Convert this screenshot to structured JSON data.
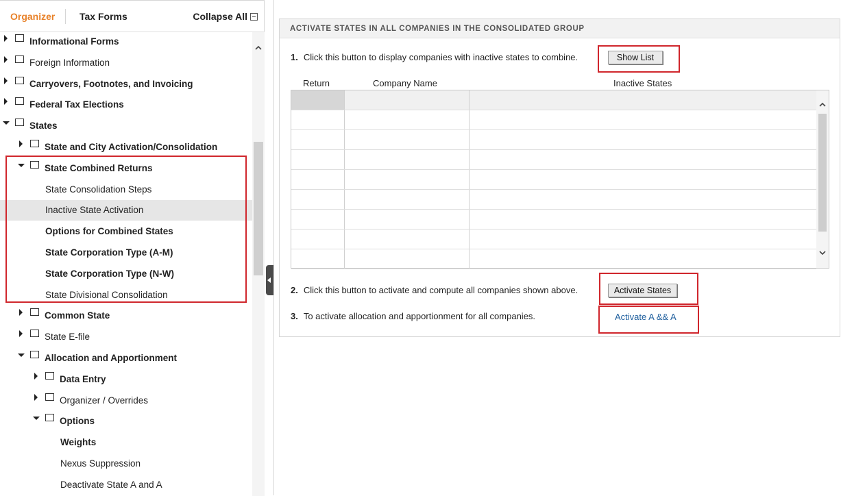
{
  "left": {
    "tabs": {
      "organizer": "Organizer",
      "tax_forms": "Tax Forms",
      "collapse_all": "Collapse All"
    },
    "tree": [
      {
        "label": "Informational Forms",
        "level": 0,
        "state": "collapsed",
        "bold": true,
        "folder": true
      },
      {
        "label": "Foreign Information",
        "level": 0,
        "state": "collapsed",
        "bold": false,
        "folder": true
      },
      {
        "label": "Carryovers, Footnotes, and Invoicing",
        "level": 0,
        "state": "collapsed",
        "bold": true,
        "folder": true
      },
      {
        "label": "Federal Tax Elections",
        "level": 0,
        "state": "collapsed",
        "bold": true,
        "folder": true
      },
      {
        "label": "States",
        "level": 0,
        "state": "expanded",
        "bold": true,
        "folder": true
      },
      {
        "label": "State and City Activation/Consolidation",
        "level": 1,
        "state": "collapsed",
        "bold": true,
        "folder": true
      },
      {
        "label": "State Combined Returns",
        "level": 1,
        "state": "expanded",
        "bold": true,
        "folder": true
      },
      {
        "label": "State Consolidation Steps",
        "level": 2,
        "state": "leaf",
        "bold": false,
        "folder": false
      },
      {
        "label": "Inactive State Activation",
        "level": 2,
        "state": "leaf",
        "bold": false,
        "folder": false,
        "selected": true
      },
      {
        "label": "Options for Combined States",
        "level": 2,
        "state": "leaf",
        "bold": true,
        "folder": false
      },
      {
        "label": "State Corporation Type (A-M)",
        "level": 2,
        "state": "leaf",
        "bold": true,
        "folder": false
      },
      {
        "label": "State Corporation Type (N-W)",
        "level": 2,
        "state": "leaf",
        "bold": true,
        "folder": false
      },
      {
        "label": "State Divisional Consolidation",
        "level": 2,
        "state": "leaf",
        "bold": false,
        "folder": false
      },
      {
        "label": "Common State",
        "level": 1,
        "state": "collapsed",
        "bold": true,
        "folder": true
      },
      {
        "label": "State E-file",
        "level": 1,
        "state": "collapsed",
        "bold": false,
        "folder": true
      },
      {
        "label": "Allocation and Apportionment",
        "level": 1,
        "state": "expanded",
        "bold": true,
        "folder": true
      },
      {
        "label": "Data Entry",
        "level": 2,
        "state": "collapsed",
        "bold": true,
        "folder": true
      },
      {
        "label": "Organizer / Overrides",
        "level": 2,
        "state": "collapsed",
        "bold": false,
        "folder": true
      },
      {
        "label": "Options",
        "level": 2,
        "state": "expanded",
        "bold": true,
        "folder": true
      },
      {
        "label": "Weights",
        "level": 3,
        "state": "leaf",
        "bold": true,
        "folder": false
      },
      {
        "label": "Nexus Suppression",
        "level": 3,
        "state": "leaf",
        "bold": false,
        "folder": false
      },
      {
        "label": "Deactivate State A and A",
        "level": 3,
        "state": "leaf",
        "bold": false,
        "folder": false
      }
    ]
  },
  "main": {
    "header": "ACTIVATE STATES IN ALL COMPANIES IN THE CONSOLIDATED GROUP",
    "step1": {
      "num": "1.",
      "text": "Click this button to display companies with inactive states to combine.",
      "button": "Show List"
    },
    "grid": {
      "columns": [
        "Return",
        "Company Name",
        "Inactive States"
      ],
      "row_count": 9
    },
    "step2": {
      "num": "2.",
      "text": "Click this button to activate and compute all companies shown above.",
      "button": "Activate States"
    },
    "step3": {
      "num": "3.",
      "text": "To activate allocation and apportionment for all companies.",
      "link": "Activate A && A"
    }
  },
  "colors": {
    "accent": "#e8822a",
    "highlight": "#d0262c",
    "link": "#1f5f9e",
    "selected_row": "#e6e6e6"
  }
}
